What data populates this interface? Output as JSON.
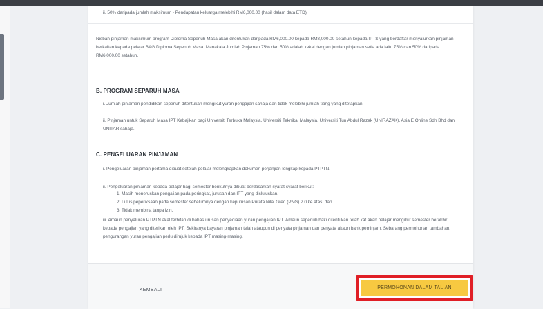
{
  "doc": {
    "top_bullet": "ii.    50% daripada jumlah maksimum  -  Pendapatan keluarga melebihi RM6,000.00 (hasil dalam data ETD)",
    "intro_para": "Nisbah pinjaman maksimum program Diploma Sepenuh Masa akan ditentukan daripada RM6,000.00 kepada RM8,000.00 setahun kepada IPTS yang berdaftar menyalurkan pinjaman berkaitan kepada pelajar BAG Diploma Sepenuh Masa. Manakala Jumlah Pinjaman 75% dan 50% adalah kekal dengan jumlah pinjaman setia ada iaitu 75% dan 50% daripada RM6,000.00 setahun.",
    "section_b": {
      "title": "B. PROGRAM SEPARUH MASA",
      "items": [
        "i.  Jumlah pinjaman pendidikan sepenuh ditentukan mengikut yuran pengajian sahaja dan tidak melebihi jumlah tiang yang ditetapkan.",
        "ii. Pinjaman untuk Separuh Masa IPT Kebajikan bagi Universiti Terbuka Malaysia, Universiti Teknikal Malaysia, Universiti Tun Abdul Razak (UNIRAZAK), Asia E Online Sdn Bhd dan UNITAR sahaja."
      ]
    },
    "section_c": {
      "title": "C. PENGELUARAN PINJAMAN",
      "item1": "i.  Pengeluaran pinjaman pertama dibuat setelah pelajar melengkapkan dokumen perjanjian lengkap kepada PTPTN.",
      "item2": "ii. Pengeluaran pinjaman kepada pelajar bagi semester berikutnya dibuat berdasarkan syarat-syarat berikut:",
      "subitems": [
        "1.     Masih meneruskan pengajian pada peringkat, jurusan dan IPT yang disluluskan.",
        "2.     Lulus peperiksaan pada semester sebelumnya dengan keputusan Purata Nilai Gred (PNG) 2.0 ke atas; dan",
        "3.     Tidak membina tanpa izin."
      ],
      "item3": "iii. Amaun penyaluran PTPTN akal terbitan di bahas urusan penyediaan yuran pengajian IPT. Amaun sepenuh baki ditentukan telah kat akan pelajar mengikut semester berakhir kepada pengajian yang diterikan oleh IPT. Sekiranya bayaran pinjaman telah ataupun di penyata pinjaman dan penyata akaun bank peminjam. Sebarang permohonan tambahan, pengurangan yuran pengajian perlu dirujuk kepada IPT masing-masing."
    }
  },
  "footer": {
    "back_label": "KEMBALI",
    "apply_label": "PERMOHONAN DALAM TALIAN"
  }
}
